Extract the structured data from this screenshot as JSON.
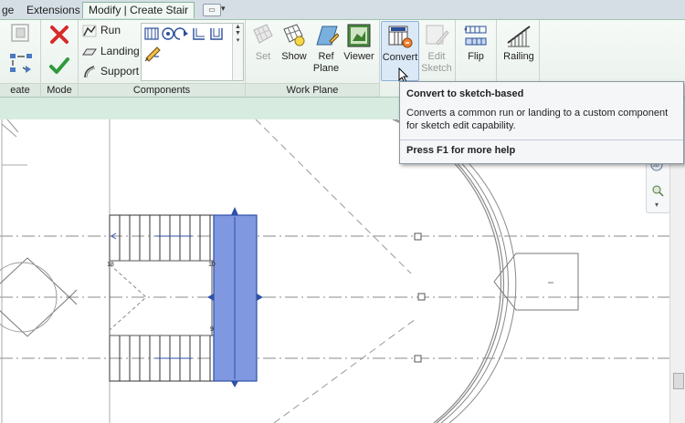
{
  "tabs": [
    {
      "label": "ge"
    },
    {
      "label": "Extensions"
    },
    {
      "label": "Modify | Create Stair"
    }
  ],
  "panels": {
    "create": {
      "label": "eate"
    },
    "mode": {
      "label": "Mode"
    },
    "components": {
      "label": "Components",
      "run": "Run",
      "landing": "Landing",
      "support": "Support"
    },
    "work_plane": {
      "label": "Work Plane",
      "set": "Set",
      "show": "Show",
      "ref_plane_1": "Ref",
      "ref_plane_2": "Plane",
      "viewer": "Viewer"
    },
    "tools": {
      "convert": "Convert",
      "edit_sketch_1": "Edit",
      "edit_sketch_2": "Sketch",
      "flip": "Flip",
      "railing": "Railing"
    }
  },
  "tooltip": {
    "title": "Convert to sketch-based",
    "description": "Converts a common run or landing to a custom component for sketch edit capability.",
    "help": "Press F1 for more help"
  },
  "canvas": {
    "dim_left": "18",
    "dim_right_top": "10",
    "dim_right_bottom": "9"
  },
  "colors": {
    "ribbon_accent": "#9cc6ad",
    "stair_highlight": "#7f98e0",
    "arrow_blue": "#2f4fa8"
  }
}
